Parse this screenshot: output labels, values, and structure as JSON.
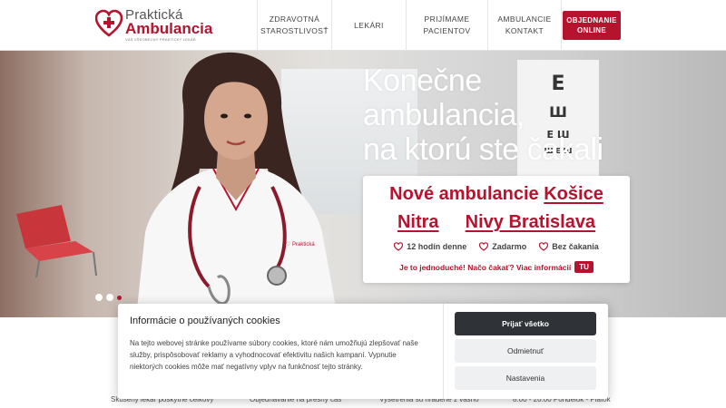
{
  "header": {
    "logo_line1": "Praktická",
    "logo_line2": "Ambulancia",
    "logo_tagline": "VÁŠ VŠEOBECNÝ PRAKTICKÝ LEKÁR",
    "nav": [
      {
        "label": "ZDRAVOTNÁ\nSTAROSTLIVOSŤ"
      },
      {
        "label": "LEKÁRI"
      },
      {
        "label": "PRIJÍMAME\nPACIENTOV"
      },
      {
        "label": "AMBULANCIE\nKONTAKT"
      }
    ],
    "cta_label": "OBJEDNANIE\nONLINE"
  },
  "hero": {
    "headline_1": "Konečne",
    "headline_2": "ambulancia,",
    "headline_3": "na ktorú ste čakali",
    "eye_chart": [
      "E",
      "Ш",
      "Е Ш",
      "Ш Е Ш"
    ],
    "card": {
      "line1_prefix": "Nové ambulancie ",
      "city_1": "Košice",
      "city_2": "Nitra",
      "city_3": "Nivy Bratislava",
      "features": [
        "12 hodín denne",
        "Zadarmo",
        "Bez čakania"
      ],
      "footer_text": "Je to jednoduché! Načo čakať? Viac informácií",
      "footer_button": "TU"
    },
    "slides": 3,
    "active_slide": 3
  },
  "below": {
    "col1": "Skúsený lekár poskytne celkový",
    "col2": "Objednávanie na presný čas",
    "col3": "Vyšetrenia sú hradené z vášho",
    "col4": "8:00 - 20:00 Pondelok - Piatok"
  },
  "cookie": {
    "title": "Informácie o používaných cookies",
    "body": "Na tejto webovej stránke používame súbory cookies, ktoré nám umožňujú zlepšovať naše služby, prispôsobovať reklamy a vyhodnocovať efektivitu našich kampaní. Vypnutie niektorých cookies môže mať negatívny vplyv na funkčnosť tejto stránky.",
    "accept_all": "Prijať všetko",
    "reject": "Odmietnuť",
    "settings": "Nastavenia"
  },
  "colors": {
    "brand": "#b5132e",
    "dark_button": "#2f3338"
  }
}
